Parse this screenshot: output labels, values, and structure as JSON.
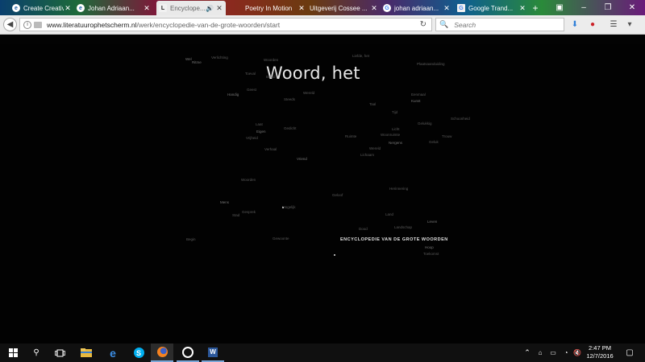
{
  "browser": {
    "tabs": [
      {
        "label": "Create Creativ...",
        "favicon": "e"
      },
      {
        "label": "Johan Adriaan...",
        "favicon": "e"
      },
      {
        "label": "Encyclope...",
        "favicon": "L"
      },
      {
        "label": "Poetry In Motion",
        "favicon": ""
      },
      {
        "label": "Uitgeverij Cossee ...",
        "favicon": ""
      },
      {
        "label": "johan adriaan...",
        "favicon": "G"
      },
      {
        "label": "Google Trand...",
        "favicon": "G"
      }
    ],
    "url_host": "www.literatuurophetscherm.nl",
    "url_path": "/werk/encyclopedie-van-de-grote-woorden/start",
    "search_placeholder": "Search"
  },
  "page": {
    "headword": "Woord, het",
    "encyclopedia_title": "ENCYCLOPEDIE VAN DE GROTE WOORDEN",
    "cloud_words": [
      "Wel",
      "Verlichting",
      "Woorden",
      "Liefde, het",
      "Plaatsaanduiding",
      "Ritme",
      "Toeval",
      "Beeld",
      "Geest",
      "Wereld",
      "Handig",
      "Steeds",
      "Eenmaal",
      "Taal",
      "Tijd",
      "Kunst",
      "Schoonheid",
      "Wereld",
      "Laat",
      "Gedicht",
      "Eigen",
      "Ruimte",
      "Woonruimte",
      "Vrijheid",
      "Gelukkig",
      "Nergens",
      "Trouw",
      "Licht",
      "Geluk",
      "Verhaal",
      "Vriend",
      "Lichaam",
      "Woorden",
      "Geloof",
      "Herinnering",
      "Mens",
      "Gesprek",
      "Stad",
      "Mogelijk",
      "Land",
      "Leven",
      "Dood",
      "Landschap",
      "Begin",
      "Gewoonte",
      "Hoop",
      "Toekomst"
    ]
  },
  "taskbar": {
    "time": "2:47 PM",
    "date": "12/7/2016"
  },
  "colors": {
    "page_bg": "#020202",
    "headword": "#e6e6e6",
    "cloud": "#5a5a5a",
    "taskbar": "#101010"
  }
}
